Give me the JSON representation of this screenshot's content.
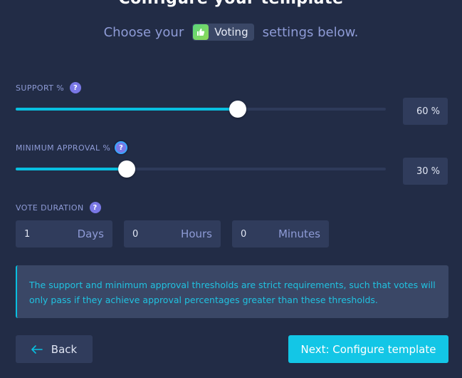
{
  "header": {
    "title_cut": "Configure your template",
    "subtitle_pre": "Choose your",
    "app_badge": {
      "label": "Voting",
      "icon": "voting-app-icon"
    },
    "subtitle_post": "settings below."
  },
  "support": {
    "label": "SUPPORT %",
    "help": "?",
    "value_percent": 60,
    "display": "60 %"
  },
  "min_approval": {
    "label": "MINIMUM APPROVAL %",
    "help": "?",
    "value_percent": 30,
    "display": "30 %"
  },
  "vote_duration": {
    "label": "VOTE DURATION",
    "help": "?",
    "days": {
      "value": "1",
      "unit": "Days"
    },
    "hours": {
      "value": "0",
      "unit": "Hours"
    },
    "minutes": {
      "value": "0",
      "unit": "Minutes"
    }
  },
  "info": {
    "text": "The support and minimum approval thresholds are strict requirements, such that votes will only pass if they achieve approval percentages greater than these thresholds."
  },
  "actions": {
    "back_label": "Back",
    "next_label": "Next: Configure template"
  },
  "colors": {
    "background": "#222c46",
    "accent": "#08bfe0",
    "help_badge": "#7a78e6",
    "field_bg": "#303c5c"
  }
}
